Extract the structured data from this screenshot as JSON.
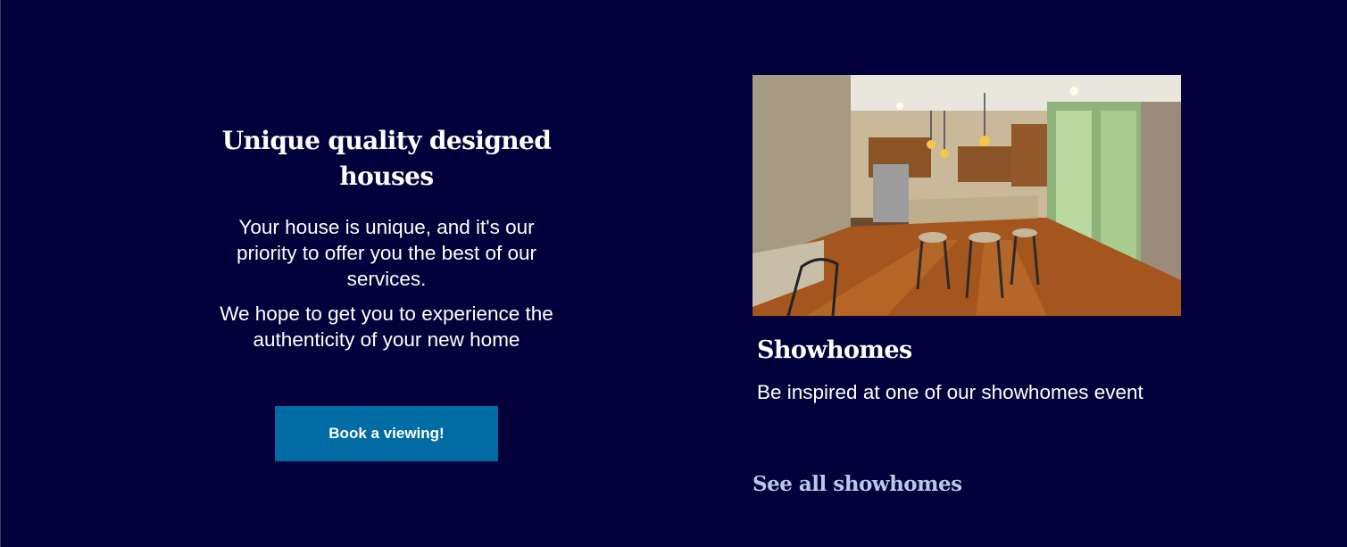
{
  "intro": {
    "heading": "Unique quality designed houses",
    "paragraph_1": "Your house is unique, and it's our priority to offer you the best of our services.",
    "paragraph_2": "We hope to get you to experience the authenticity of your new home",
    "cta_label": "Book a viewing!"
  },
  "showhomes": {
    "image_icon": "kitchen-photo",
    "title": "Showhomes",
    "text": "Be inspired at one of our showhomes event",
    "link_label": "See all showhomes"
  },
  "colors": {
    "background": "#02003a",
    "button": "#016ba3",
    "link": "#b7c8e8",
    "text": "#ffffff"
  }
}
